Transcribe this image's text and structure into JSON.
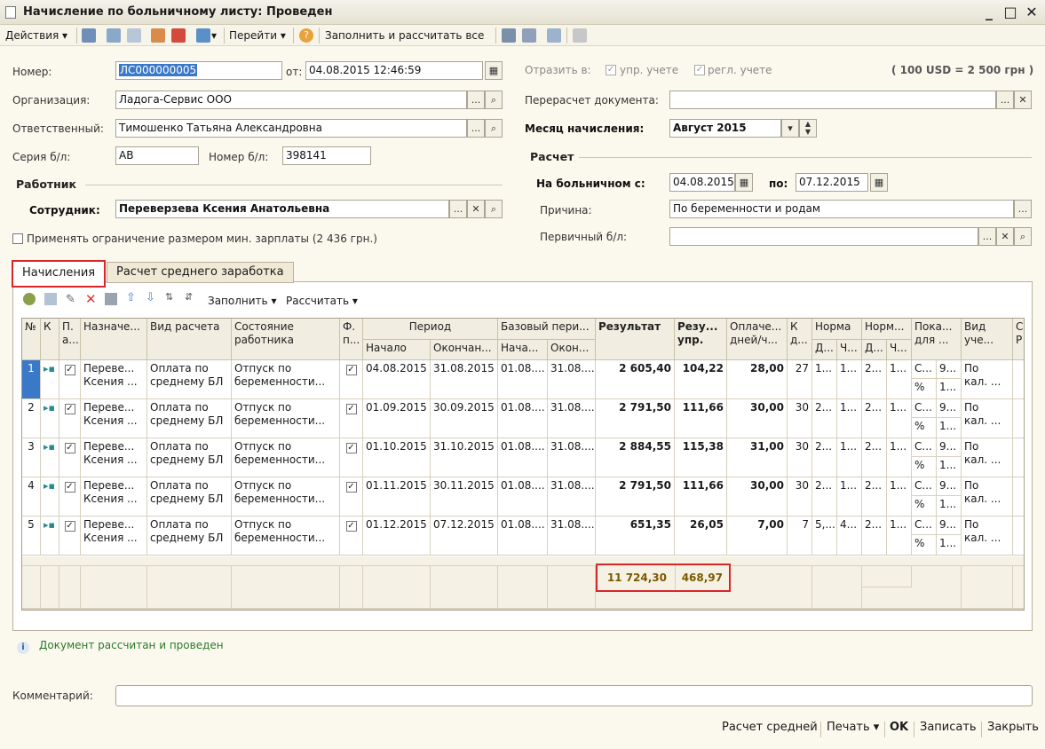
{
  "window": {
    "title": "Начисление по больничному листу: Проведен"
  },
  "toolbar": {
    "actions": "Действия",
    "goto": "Перейти",
    "fill_calc": "Заполнить и рассчитать все"
  },
  "form": {
    "number_label": "Номер:",
    "number": "ЛС000000005",
    "date_label": "от:",
    "date": "04.08.2015 12:46:59",
    "org_label": "Организация:",
    "org": "Ладога-Сервис ООО",
    "resp_label": "Ответственный:",
    "resp": "Тимошенко Татьяна Александровна",
    "series_label": "Серия б/л:",
    "series": "АВ",
    "numbl_label": "Номер б/л:",
    "numbl": "398141",
    "reflect_label": "Отразить в:",
    "mgmt": "упр. учете",
    "reg": "регл. учете",
    "rate": "( 100 USD = 2 500 грн )",
    "recalc_label": "Перерасчет документа:",
    "recalc": "",
    "month_label": "Месяц начисления:",
    "month": "Август 2015",
    "worker_section": "Работник",
    "employee_label": "Сотрудник:",
    "employee": "Переверзева Ксения Анатольевна",
    "limit_label": "Применять ограничение размером мин. зарплаты (2 436 грн.)",
    "calc_section": "Расчет",
    "sick_from_label": "На больничном с:",
    "sick_from": "04.08.2015",
    "sick_to_label": "по:",
    "sick_to": "07.12.2015",
    "reason_label": "Причина:",
    "reason": "По беременности и родам",
    "primary_label": "Первичный б/л:",
    "primary": ""
  },
  "tabs": [
    "Начисления",
    "Расчет среднего заработка"
  ],
  "grid_toolbar": {
    "fill": "Заполнить",
    "calc": "Рассчитать"
  },
  "grid": {
    "headers": {
      "n": "№",
      "k": "К",
      "p": "П.",
      "p2": "а...",
      "name": "Назначе...",
      "kind": "Вид расчета",
      "state": "Состояние",
      "state2": "работника",
      "f": "Ф.",
      "f2": "п...",
      "period": "Период",
      "start": "Начало",
      "end": "Окончан...",
      "base": "Базовый пери...",
      "bstart": "Нача...",
      "bend": "Окон...",
      "result": "Результат",
      "resu": "Резу...",
      "resu2": "упр.",
      "paid": "Оплаче...",
      "paid2": "дней/ч...",
      "k2": "К",
      "k3": "д...",
      "norm": "Норма",
      "nd": "Д...",
      "nc": "Ч...",
      "norm2": "Норм...",
      "n2d": "Д...",
      "n2c": "Ч...",
      "ind": "Пока...",
      "ind2": "для ...",
      "vid": "Вид",
      "vid2": "уче...",
      "c": "С",
      "r": "Р"
    },
    "rows": [
      {
        "n": "1",
        "name1": "Переве...",
        "name2": "Ксения ...",
        "kind1": "Оплата по",
        "kind2": "среднему БЛ",
        "st1": "Отпуск по",
        "st2": "беременности...",
        "start": "04.08.2015",
        "end": "31.08.2015",
        "bs": "01.08....",
        "be": "31.08....",
        "result": "2 605,40",
        "resu": "104,22",
        "paid": "28,00",
        "k": "27",
        "nd": "1...",
        "nc": "1...",
        "n2d": "2...",
        "n2c": "1...",
        "i1": "С...",
        "i1b": "9...",
        "i2": "%",
        "i2b": "1...",
        "v1": "По",
        "v2": "кал. ..."
      },
      {
        "n": "2",
        "name1": "Переве...",
        "name2": "Ксения ...",
        "kind1": "Оплата по",
        "kind2": "среднему БЛ",
        "st1": "Отпуск по",
        "st2": "беременности...",
        "start": "01.09.2015",
        "end": "30.09.2015",
        "bs": "01.08....",
        "be": "31.08....",
        "result": "2 791,50",
        "resu": "111,66",
        "paid": "30,00",
        "k": "30",
        "nd": "2...",
        "nc": "1...",
        "n2d": "2...",
        "n2c": "1...",
        "i1": "С...",
        "i1b": "9...",
        "i2": "%",
        "i2b": "1...",
        "v1": "По",
        "v2": "кал. ..."
      },
      {
        "n": "3",
        "name1": "Переве...",
        "name2": "Ксения ...",
        "kind1": "Оплата по",
        "kind2": "среднему БЛ",
        "st1": "Отпуск по",
        "st2": "беременности...",
        "start": "01.10.2015",
        "end": "31.10.2015",
        "bs": "01.08....",
        "be": "31.08....",
        "result": "2 884,55",
        "resu": "115,38",
        "paid": "31,00",
        "k": "30",
        "nd": "2...",
        "nc": "1...",
        "n2d": "2...",
        "n2c": "1...",
        "i1": "С...",
        "i1b": "9...",
        "i2": "%",
        "i2b": "1...",
        "v1": "По",
        "v2": "кал. ..."
      },
      {
        "n": "4",
        "name1": "Переве...",
        "name2": "Ксения ...",
        "kind1": "Оплата по",
        "kind2": "среднему БЛ",
        "st1": "Отпуск по",
        "st2": "беременности...",
        "start": "01.11.2015",
        "end": "30.11.2015",
        "bs": "01.08....",
        "be": "31.08....",
        "result": "2 791,50",
        "resu": "111,66",
        "paid": "30,00",
        "k": "30",
        "nd": "2...",
        "nc": "1...",
        "n2d": "2...",
        "n2c": "1...",
        "i1": "С...",
        "i1b": "9...",
        "i2": "%",
        "i2b": "1...",
        "v1": "По",
        "v2": "кал. ..."
      },
      {
        "n": "5",
        "name1": "Переве...",
        "name2": "Ксения ...",
        "kind1": "Оплата по",
        "kind2": "среднему БЛ",
        "st1": "Отпуск по",
        "st2": "беременности...",
        "start": "01.12.2015",
        "end": "07.12.2015",
        "bs": "01.08....",
        "be": "31.08....",
        "result": "651,35",
        "resu": "26,05",
        "paid": "7,00",
        "k": "7",
        "nd": "5,...",
        "nc": "4...",
        "n2d": "2...",
        "n2c": "1...",
        "i1": "С...",
        "i1b": "9...",
        "i2": "%",
        "i2b": "1...",
        "v1": "По",
        "v2": "кал. ..."
      }
    ],
    "total_result": "11 724,30",
    "total_resu": "468,97"
  },
  "status": "Документ рассчитан и проведен",
  "comment_label": "Комментарий:",
  "comment": "",
  "bottom": {
    "avg": "Расчет средней",
    "print": "Печать",
    "ok": "OK",
    "save": "Записать",
    "close": "Закрыть"
  }
}
